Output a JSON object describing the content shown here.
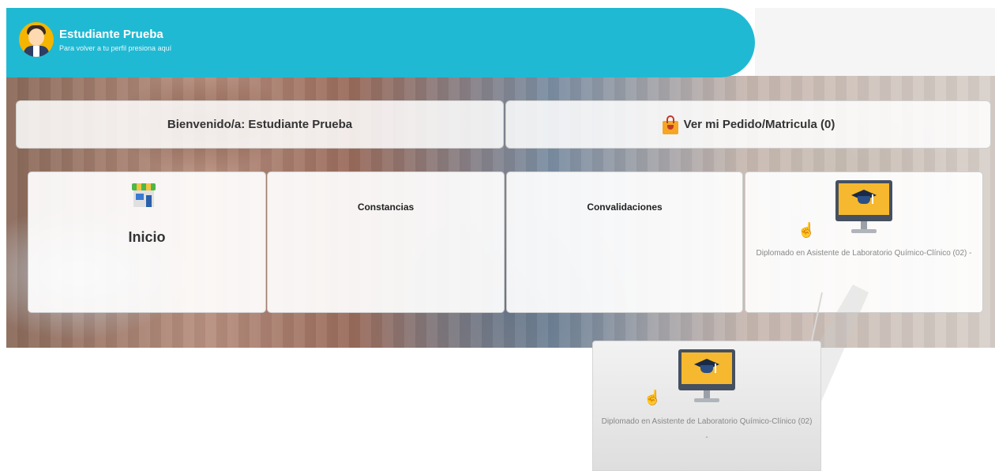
{
  "header": {
    "user_name": "Estudiante Prueba",
    "subtitle": "Para volver a tu perfil presiona aquí",
    "accent_color": "#20b9d3"
  },
  "welcome_card": {
    "label": "Bienvenido/a: Estudiante Prueba"
  },
  "order_card": {
    "icon": "shopping-bag-icon",
    "label": "Ver mi Pedido/Matricula (0)"
  },
  "tiles": [
    {
      "icon": "store-icon",
      "label": "Inicio"
    },
    {
      "label": "Constancias"
    },
    {
      "label": "Convalidaciones"
    },
    {
      "icon": "graduation-monitor-icon",
      "label": "Diplomado en Asistente de Laboratorio Químico-Clínico (02) -"
    }
  ],
  "zoom_callout": {
    "icon": "graduation-monitor-icon",
    "label": "Diplomado en Asistente de Laboratorio Químico-Clínico (02) -"
  },
  "cursor": "hand-pointer-icon"
}
